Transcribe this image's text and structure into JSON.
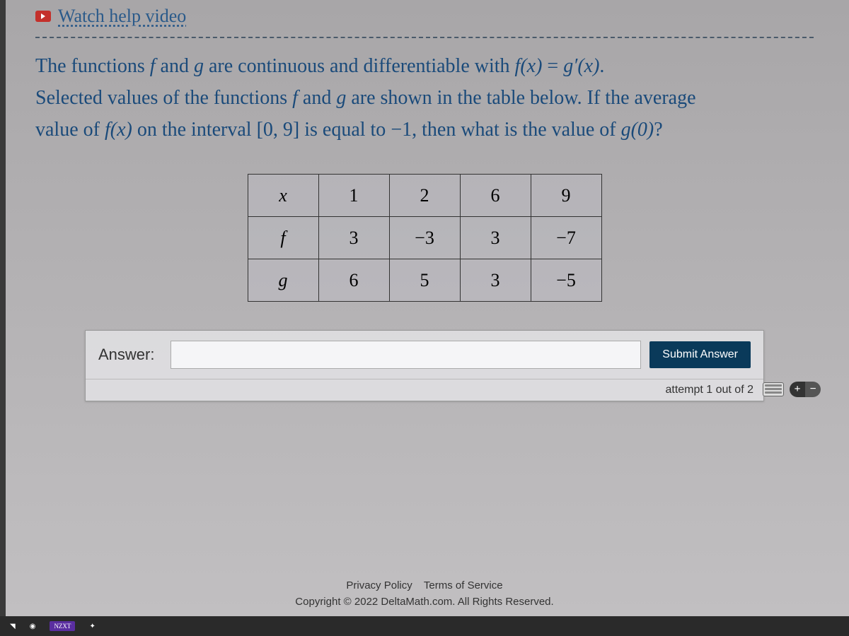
{
  "help": {
    "link_text": "Watch help video"
  },
  "problem": {
    "line1_pre": "The functions ",
    "f": "f",
    "and": " and ",
    "g": "g",
    "line1_mid": " are continuous and differentiable with ",
    "eq_lhs": "f(x)",
    "eq_eq": " = ",
    "eq_rhs": "g′(x)",
    "period": ".",
    "line2_pre": "Selected values of the functions ",
    "line2_mid": " are shown in the table below. If the average",
    "line3_pre": "value of ",
    "fx": "f(x)",
    "line3_mid": " on the interval ",
    "interval": "[0, 9]",
    "line3_mid2": " is equal to ",
    "avgval": "−1",
    "line3_end": ", then what is the value of ",
    "g0": "g(0)",
    "qmark": "?"
  },
  "table": {
    "headers": [
      "x",
      "1",
      "2",
      "6",
      "9"
    ],
    "rows": [
      {
        "label": "f",
        "vals": [
          "3",
          "−3",
          "3",
          "−7"
        ]
      },
      {
        "label": "g",
        "vals": [
          "6",
          "5",
          "3",
          "−5"
        ]
      }
    ]
  },
  "answer": {
    "label": "Answer:",
    "value": "",
    "placeholder": "",
    "submit": "Submit Answer",
    "attempt": "attempt 1 out of 2"
  },
  "footer": {
    "privacy": "Privacy Policy",
    "terms": "Terms of Service",
    "copyright": "Copyright © 2022 DeltaMath.com. All Rights Reserved."
  },
  "taskbar": {
    "nzxt": "NZXT"
  }
}
